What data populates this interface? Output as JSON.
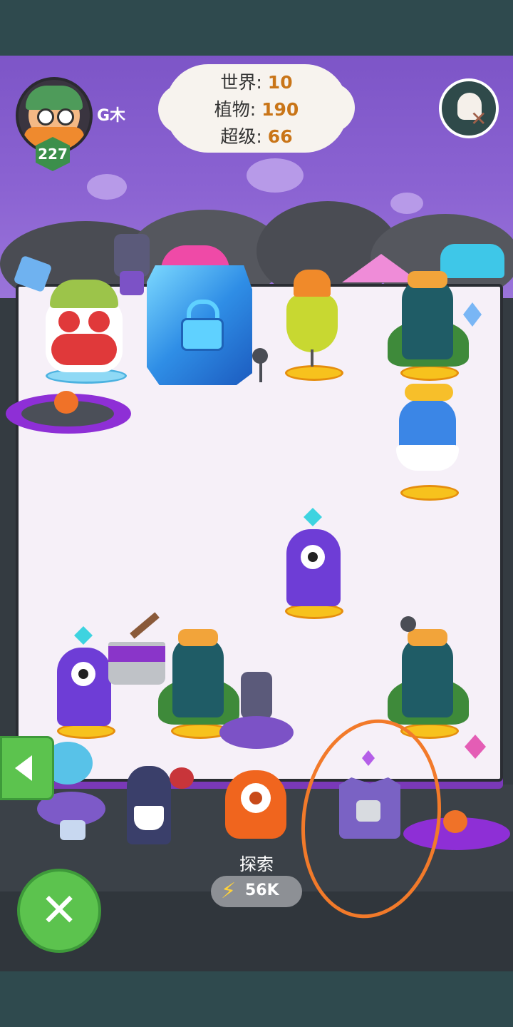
{
  "player": {
    "name": "G木",
    "level": "227"
  },
  "stats": {
    "world_label": "世界:",
    "world_value": "10",
    "plants_label": "植物:",
    "plants_value": "190",
    "super_label": "超级:",
    "super_value": "66"
  },
  "explore": {
    "label": "探索",
    "cost": "56K"
  },
  "icons": {
    "close": "close-icon",
    "back": "left-arrow-icon",
    "lock": "lock-icon",
    "skull": "skull-icon",
    "energy": "lightning-icon"
  },
  "colors": {
    "sky": "#8b63d2",
    "accent_green": "#5cc34e",
    "stat_value": "#c97518",
    "annotation": "#f27a2a"
  }
}
